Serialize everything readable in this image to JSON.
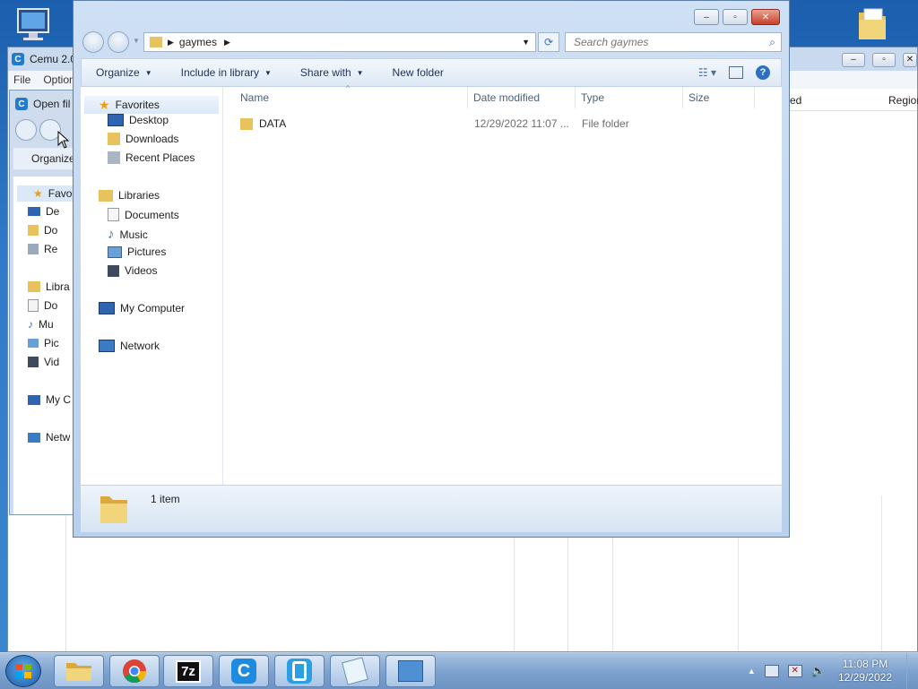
{
  "background_window": {
    "title": "Cemu 2.0",
    "menu": [
      "File",
      "Option"
    ],
    "columns": [
      "ed",
      "Region"
    ]
  },
  "open_file_dialog": {
    "title": "Open fil",
    "organize": "Organize",
    "tree": [
      "Favo",
      "De",
      "Do",
      "Re",
      "Libra",
      "Do",
      "Mu",
      "Pic",
      "Vid",
      "My C",
      "Netw"
    ]
  },
  "explorer": {
    "breadcrumb": "gaymes",
    "search_placeholder": "Search gaymes",
    "toolbar": {
      "organize": "Organize",
      "include_in_library": "Include in library",
      "share_with": "Share with",
      "new_folder": "New folder"
    },
    "nav": {
      "favorites": "Favorites",
      "desktop": "Desktop",
      "downloads": "Downloads",
      "recent_places": "Recent Places",
      "libraries": "Libraries",
      "documents": "Documents",
      "music": "Music",
      "pictures": "Pictures",
      "videos": "Videos",
      "my_computer": "My Computer",
      "network": "Network"
    },
    "columns": {
      "name": "Name",
      "date_modified": "Date modified",
      "type": "Type",
      "size": "Size"
    },
    "files": [
      {
        "name": "DATA",
        "date_modified": "12/29/2022 11:07 ...",
        "type": "File folder",
        "size": ""
      }
    ],
    "status": "1 item"
  },
  "taskbar": {
    "apps": [
      "windows-explorer",
      "chrome",
      "7-zip",
      "cemu",
      "wii-u-usb-helper",
      "notepad",
      "control-panel"
    ],
    "labels": {
      "sevenzip": "7z",
      "cemu": "C"
    },
    "time": "11:08 PM",
    "date": "12/29/2022"
  },
  "colors": {
    "desktop": "#2f7bc9",
    "window_frame": "#b8d0ec",
    "close_button": "#c6412b",
    "folder": "#e8c25c"
  }
}
